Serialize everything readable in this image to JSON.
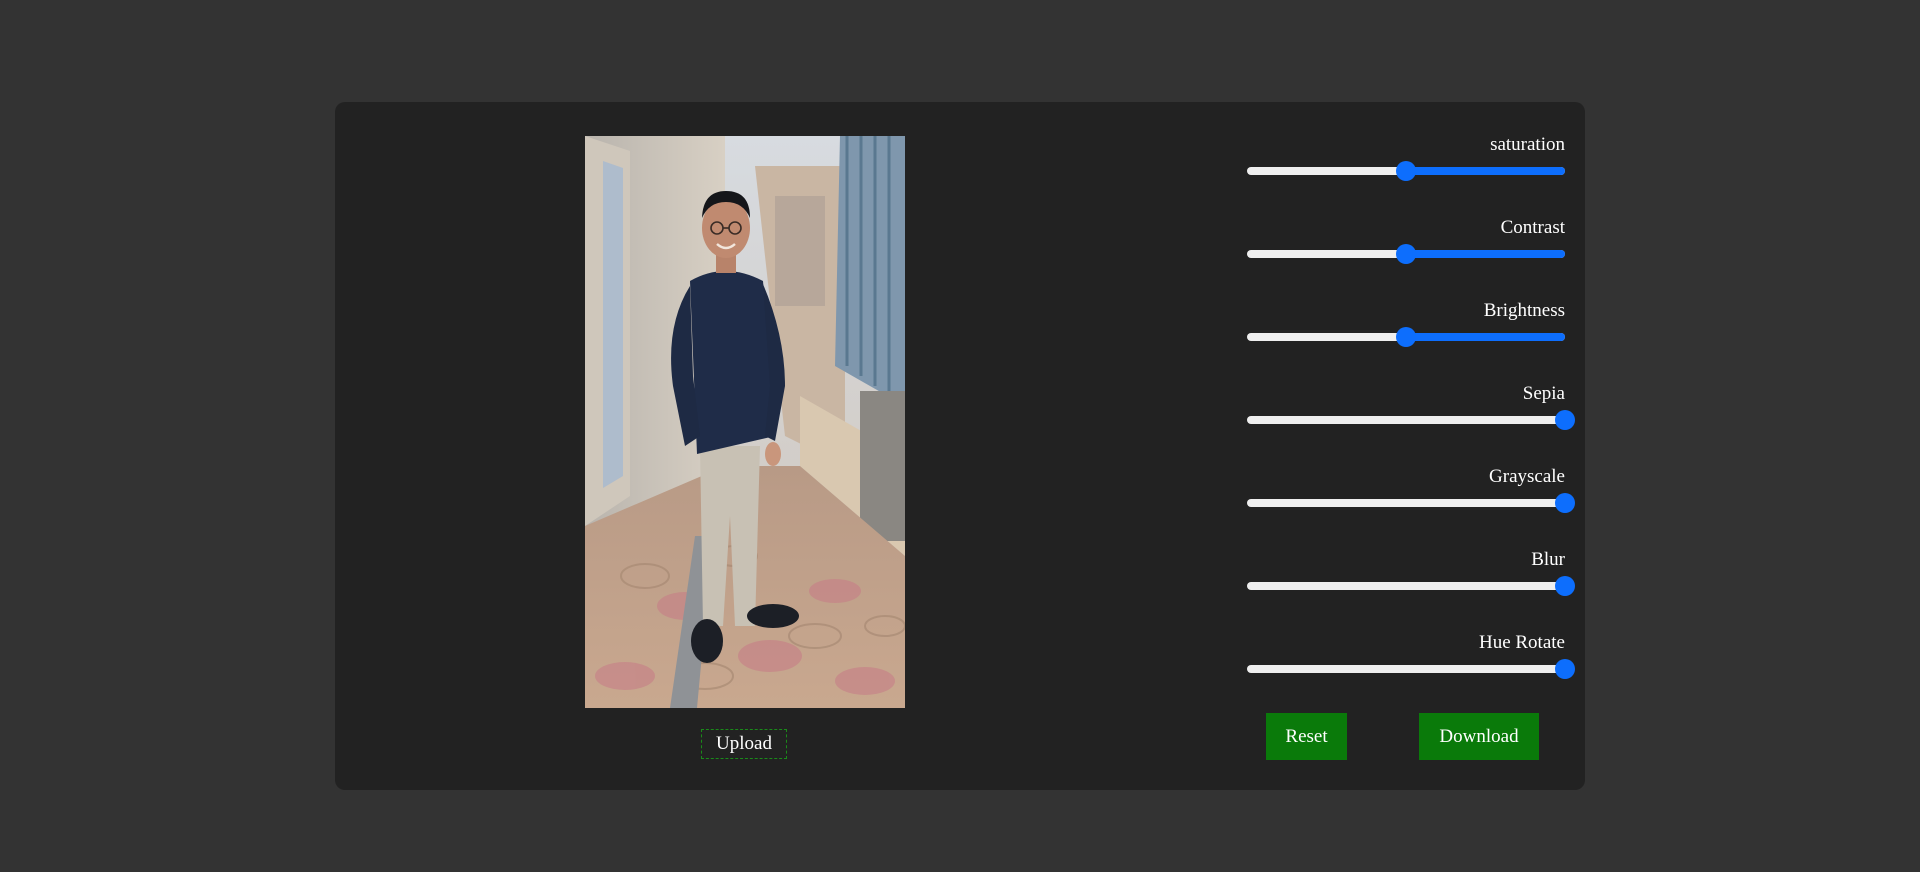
{
  "editor": {
    "photo_alt": "Photo of a man standing on a tiled walkway",
    "upload_label": "Upload"
  },
  "filters": [
    {
      "id": "saturation",
      "label": "saturation",
      "value": 0.5
    },
    {
      "id": "contrast",
      "label": "Contrast",
      "value": 0.5
    },
    {
      "id": "brightness",
      "label": "Brightness",
      "value": 0.5
    },
    {
      "id": "sepia",
      "label": "Sepia",
      "value": 1.0
    },
    {
      "id": "grayscale",
      "label": "Grayscale",
      "value": 1.0
    },
    {
      "id": "blur",
      "label": "Blur",
      "value": 1.0
    },
    {
      "id": "hue-rotate",
      "label": "Hue Rotate",
      "value": 1.0
    }
  ],
  "actions": {
    "reset_label": "Reset",
    "download_label": "Download"
  },
  "colors": {
    "page_bg": "#333333",
    "panel_bg": "#222222",
    "slider_accent": "#0d6efd",
    "slider_track": "#efefef",
    "button_green": "#0a7a0a",
    "upload_border": "#1a8a1a"
  }
}
